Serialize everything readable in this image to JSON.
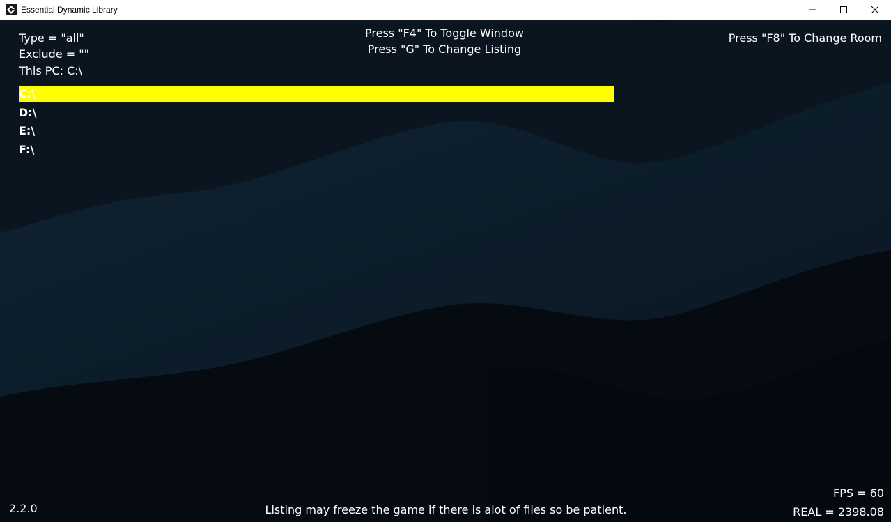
{
  "window": {
    "title": "Essential Dynamic Library",
    "icon": "gamemaker-icon",
    "controls": [
      "minimize-icon",
      "maximize-icon",
      "close-icon"
    ]
  },
  "info": {
    "type_line": "Type = \"all\"",
    "exclude_line": "Exclude = \"\"",
    "path_line": "This PC: C:\\"
  },
  "hints": {
    "toggle_window": "Press \"F4\" To Toggle Window",
    "change_listing": "Press \"G\" To Change Listing",
    "change_room": "Press \"F8\" To Change Room"
  },
  "drives": [
    {
      "label": "C:\\",
      "selected": true
    },
    {
      "label": "D:\\",
      "selected": false
    },
    {
      "label": "E:\\",
      "selected": false
    },
    {
      "label": "F:\\",
      "selected": false
    }
  ],
  "footer": {
    "version": "2.2.0",
    "notice": "Listing may freeze the game if there is alot of files so be patient.",
    "fps": "FPS = 60",
    "real": "REAL = 2398.08"
  },
  "colors": {
    "selection": "#ffff00",
    "text": "#ffffff",
    "background": "#081019"
  }
}
